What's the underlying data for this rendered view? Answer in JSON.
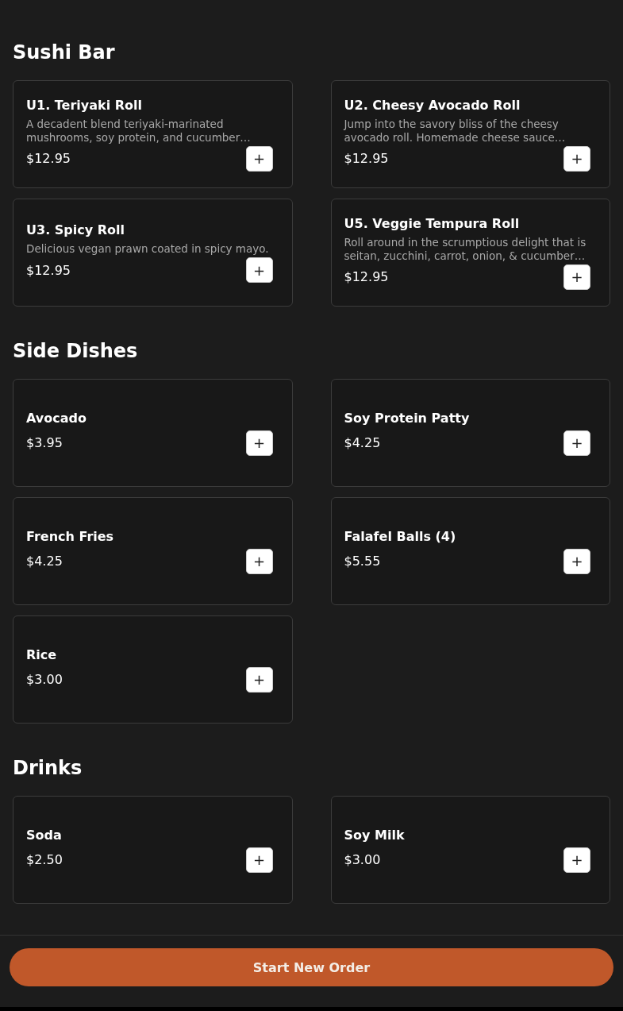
{
  "sections": [
    {
      "title": "Sushi Bar",
      "items": [
        {
          "name": "U1. Teriyaki Roll",
          "description": "A decadent blend teriyaki-marinated mushrooms, soy protein, and cucumber…",
          "price": "$12.95",
          "add": "+"
        },
        {
          "name": "U2. Cheesy Avocado Roll",
          "description": "Jump into the savory bliss of the cheesy avocado roll. Homemade cheese sauce…",
          "price": "$12.95",
          "add": "+"
        },
        {
          "name": "U3. Spicy Roll",
          "description": "Delicious vegan prawn coated in spicy mayo.",
          "price": "$12.95",
          "add": "+"
        },
        {
          "name": "U5. Veggie Tempura Roll",
          "description": "Roll around in the scrumptious delight that is seitan, zucchini, carrot, onion, & cucumber…",
          "price": "$12.95",
          "add": "+"
        }
      ]
    },
    {
      "title": "Side Dishes",
      "items": [
        {
          "name": "Avocado",
          "price": "$3.95",
          "add": "+"
        },
        {
          "name": "Soy Protein Patty",
          "price": "$4.25",
          "add": "+"
        },
        {
          "name": "French Fries",
          "price": "$4.25",
          "add": "+"
        },
        {
          "name": "Falafel Balls (4)",
          "price": "$5.55",
          "add": "+"
        },
        {
          "name": "Rice",
          "price": "$3.00",
          "add": "+"
        }
      ]
    },
    {
      "title": "Drinks",
      "items": [
        {
          "name": "Soda",
          "price": "$2.50",
          "add": "+"
        },
        {
          "name": "Soy Milk",
          "price": "$3.00",
          "add": "+"
        }
      ]
    }
  ],
  "footer": {
    "button": "Start New Order"
  }
}
